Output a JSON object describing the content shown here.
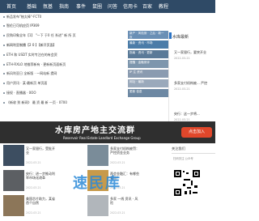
{
  "nav": {
    "items": [
      "首页",
      "基础",
      "氛基",
      "指南",
      "事件",
      "鼠圈",
      "问答",
      "信用卡",
      "百家",
      "教程"
    ]
  },
  "news": {
    "items": [
      {
        "text": "新品发布\"柚太棒\"-FCT0",
        "highlight": false
      },
      {
        "text": "智伦已可机应页 IP369",
        "highlight": true
      },
      {
        "text": "民购印象全年【1】 \"一下 于0 任 系进\" 新 所 页",
        "highlight": false
      },
      {
        "text": "新网利亚制播【2 0 】【新开页面】",
        "highlight": true
      },
      {
        "text": "ETH 和 USDT 实时专注在的有会资",
        "highlight": false
      },
      {
        "text": "ETH-RXLO 地推荐新有 · 更新新页面新页",
        "highlight": false
      },
      {
        "text": "新风利亚日 全新版 · 一网站新 提网",
        "highlight": false
      },
      {
        "text": "用户资讯 · 某·最新页 单页面",
        "highlight": false
      },
      {
        "text": "接权 · 直播器 · 0OO",
        "highlight": false
      },
      {
        "text": "《新收 到 新网》 最 资 最 新 一页 · 0700",
        "highlight": false
      }
    ]
  },
  "middle_cards": [
    {
      "text": "新产 · 风险测 · 之后 · 新一页",
      "color": "#6a8fb5"
    },
    {
      "text": "最新 · 资讯 · 市场",
      "color": "#4b7ca8"
    },
    {
      "text": "指南 · 资讯 · 更新",
      "color": "#5a7a98"
    },
    {
      "text": "提醒 · 金融测评",
      "color": "#7d96ad"
    },
    {
      "text": "IP 注 资讯",
      "color": "#8a9bb0"
    },
    {
      "text": "网址 · 最新",
      "color": "#9aa9bb"
    },
    {
      "text": "更新 信息",
      "color": "#6d88a3"
    }
  ],
  "right": {
    "title": "水库最新",
    "items": [
      {
        "title": "又一家银行，要突开业",
        "meta": "2022-03-21"
      },
      {
        "title": "多家支付机构被... 严控",
        "meta": "2022-03-21"
      },
      {
        "title": "央行：这一步将...",
        "meta": "2022-03-21"
      }
    ]
  },
  "banner": {
    "title": "水库房产地主交流群",
    "subtitle": "Reservoir Real Estate Landlord Exchange Group",
    "button": "点击加入"
  },
  "cards": [
    {
      "title": "又一家银行，受批开业",
      "meta": "2022-03-21"
    },
    {
      "title": "多家支付机构被罚：严控资金业务",
      "meta": "2022-03-21"
    },
    {
      "title": "央行：进一步推动利率市场化改革",
      "meta": "2022-03-21"
    },
    {
      "title": "两会金融汇：有哪些看点？",
      "meta": "2022-03-21"
    },
    {
      "title": "美国芯片助力，某省 首个自然",
      "meta": "2022-03-21"
    },
    {
      "title": "多家 一线 资讯 · 风险",
      "meta": "2022-03-21"
    }
  ],
  "side_pane": {
    "head": "关注我们",
    "note": "扫码关注 公众号"
  },
  "watermark": "速民库",
  "colors": {
    "nav_bg": "#2f4a66",
    "banner_bg": "#2f2f2f",
    "button_bg": "#e0472b",
    "accent": "#2c74c5"
  }
}
